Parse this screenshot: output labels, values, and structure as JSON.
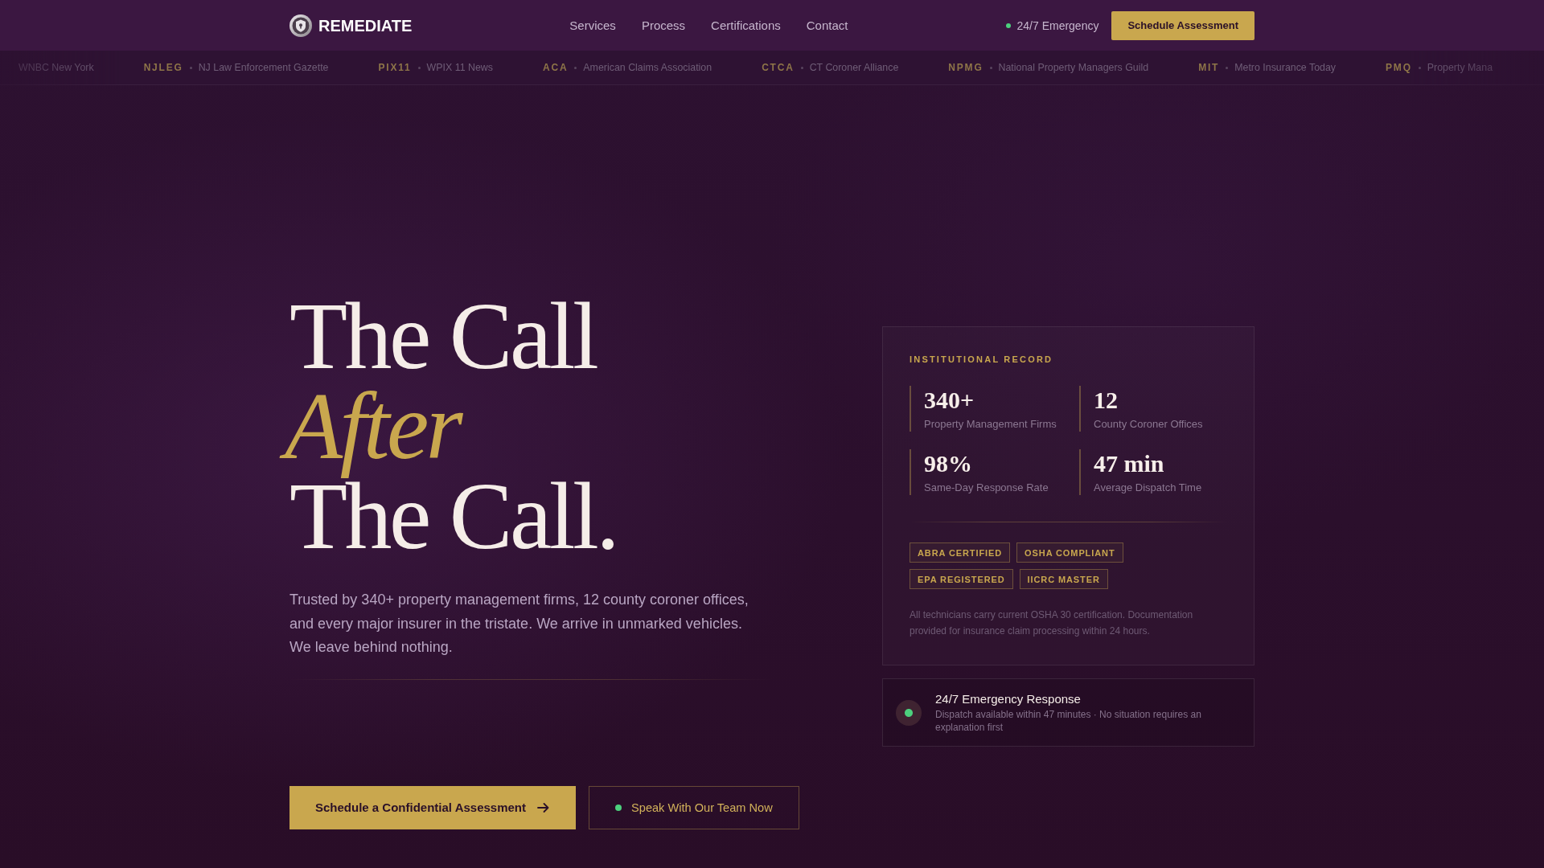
{
  "nav": {
    "brand": "REMEDIATE",
    "links": [
      "Services",
      "Process",
      "Certifications",
      "Contact"
    ],
    "emergency": "24/7 Emergency",
    "cta": "Schedule Assessment"
  },
  "ticker": [
    {
      "name": "WNBC New York"
    },
    {
      "abbr": "NJLEG",
      "name": "NJ Law Enforcement Gazette"
    },
    {
      "abbr": "PIX11",
      "name": "WPIX 11 News"
    },
    {
      "abbr": "ACA",
      "name": "American Claims Association"
    },
    {
      "abbr": "CTCA",
      "name": "CT Coroner Alliance"
    },
    {
      "abbr": "NPMG",
      "name": "National Property Managers Guild"
    },
    {
      "abbr": "MIT",
      "name": "Metro Insurance Today"
    },
    {
      "abbr": "PMQ",
      "name": "Property Mana"
    }
  ],
  "hero": {
    "title": "The Call *After* The Call.",
    "description": "Trusted by 340+ property management firms, 12 county coroner offices, and every major insurer in the tristate. We arrive in unmarked vehicles. We leave behind nothing.",
    "primary_button": "Schedule a Confidential Assessment",
    "secondary_button": "Speak With Our Team Now"
  },
  "record": {
    "label": "INSTITUTIONAL RECORD",
    "stats": [
      {
        "value": "340+",
        "label": "Property Management Firms"
      },
      {
        "value": "12",
        "label": "County Coroner Offices"
      },
      {
        "value": "98%",
        "label": "Same-Day Response Rate"
      },
      {
        "value": "47 min",
        "label": "Average Dispatch Time"
      }
    ],
    "badges": [
      "ABRA CERTIFIED",
      "OSHA COMPLIANT",
      "EPA REGISTERED",
      "IICRC MASTER"
    ],
    "note": "All technicians carry current OSHA 30 certification. Documentation provided for insurance claim processing within 24 hours."
  },
  "emergency_card": {
    "title": "24/7 Emergency Response",
    "text": "Dispatch available within 47 minutes · No situation requires an explanation first"
  }
}
